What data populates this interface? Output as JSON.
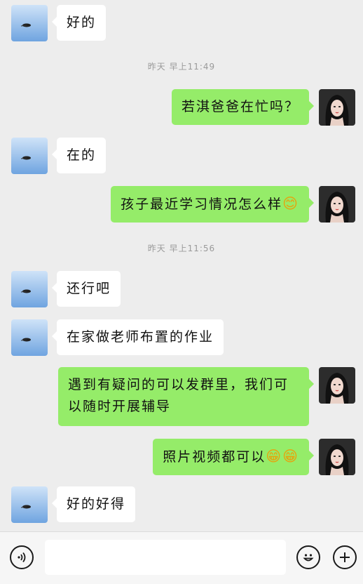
{
  "messages": [
    {
      "side": "left",
      "text": "好的"
    },
    {
      "side": "right",
      "text": "若淇爸爸在忙吗？"
    },
    {
      "side": "left",
      "text": "在的"
    },
    {
      "side": "right",
      "text": "孩子最近学习情况怎么样",
      "emoji": "😊"
    },
    {
      "side": "left",
      "text": "还行吧"
    },
    {
      "side": "left",
      "text": "在家做老师布置的作业"
    },
    {
      "side": "right",
      "text": "遇到有疑问的可以发群里，我们可以随时开展辅导"
    },
    {
      "side": "right",
      "text": "照片视频都可以",
      "emoji": "😁😁"
    },
    {
      "side": "left",
      "text": "好的好得"
    }
  ],
  "timestamps": [
    "昨天 早上11:49",
    "昨天 早上11:56"
  ],
  "input": {
    "value": ""
  },
  "icons": {
    "voice": "voice-icon",
    "emoji": "emoji-icon",
    "plus": "plus-icon"
  },
  "colors": {
    "sent_bubble": "#95ec69",
    "received_bubble": "#ffffff",
    "background": "#ededed"
  }
}
